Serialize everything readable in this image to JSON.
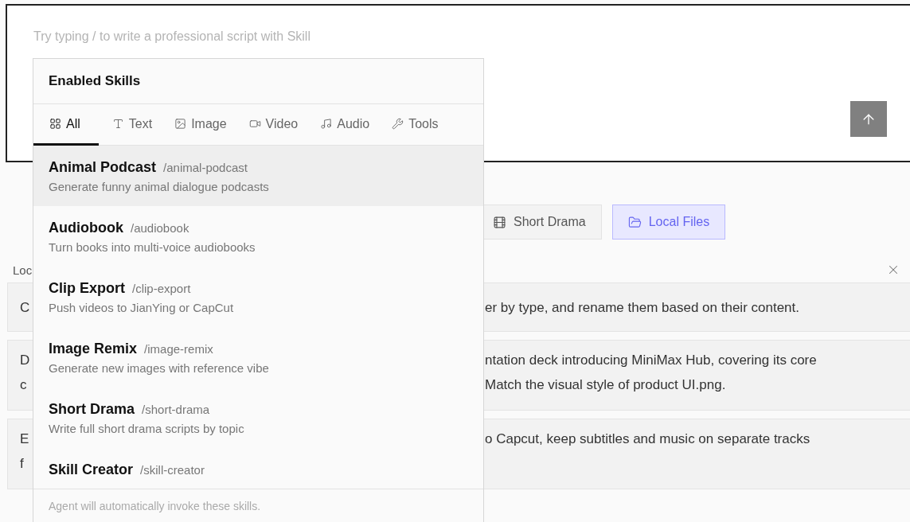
{
  "composer": {
    "placeholder": "Try typing / to write a professional script with Skill",
    "send_button": {
      "disabled": true
    }
  },
  "chips": [
    {
      "label": "Short Drama",
      "selected": false
    },
    {
      "label": "Local Files",
      "selected": true
    }
  ],
  "section": {
    "title": "Loc"
  },
  "prompt_cards": [
    {
      "lines": [
        {
          "left": "C",
          "right": "er by type, and rename them based on their content."
        }
      ]
    },
    {
      "lines": [
        {
          "left": "D",
          "right": "ntation deck introducing MiniMax Hub, covering its core"
        },
        {
          "left": "c",
          "right": "Match the visual style of product UI.png."
        }
      ]
    },
    {
      "lines": [
        {
          "left": "E",
          "right": "o Capcut, keep subtitles and music on separate tracks"
        },
        {
          "left": "f"
        }
      ]
    }
  ],
  "skills_popover": {
    "title": "Enabled Skills",
    "tabs": [
      {
        "label": "All",
        "selected": true
      },
      {
        "label": "Text",
        "selected": false
      },
      {
        "label": "Image",
        "selected": false
      },
      {
        "label": "Video",
        "selected": false
      },
      {
        "label": "Audio",
        "selected": false
      },
      {
        "label": "Tools",
        "selected": false
      }
    ],
    "skills": [
      {
        "name": "Animal Podcast",
        "command": "/animal-podcast",
        "description": "Generate funny animal dialogue podcasts",
        "selected": true
      },
      {
        "name": "Audiobook",
        "command": "/audiobook",
        "description": "Turn books into multi-voice audiobooks",
        "selected": false
      },
      {
        "name": "Clip Export",
        "command": "/clip-export",
        "description": "Push videos to JianYing or CapCut",
        "selected": false
      },
      {
        "name": "Image Remix",
        "command": "/image-remix",
        "description": "Generate new images with reference vibe",
        "selected": false
      },
      {
        "name": "Short Drama",
        "command": "/short-drama",
        "description": "Write full short drama scripts by topic",
        "selected": false
      },
      {
        "name": "Skill Creator",
        "command": "/skill-creator",
        "selected": false
      }
    ],
    "footer": "Agent will automatically invoke these skills."
  }
}
